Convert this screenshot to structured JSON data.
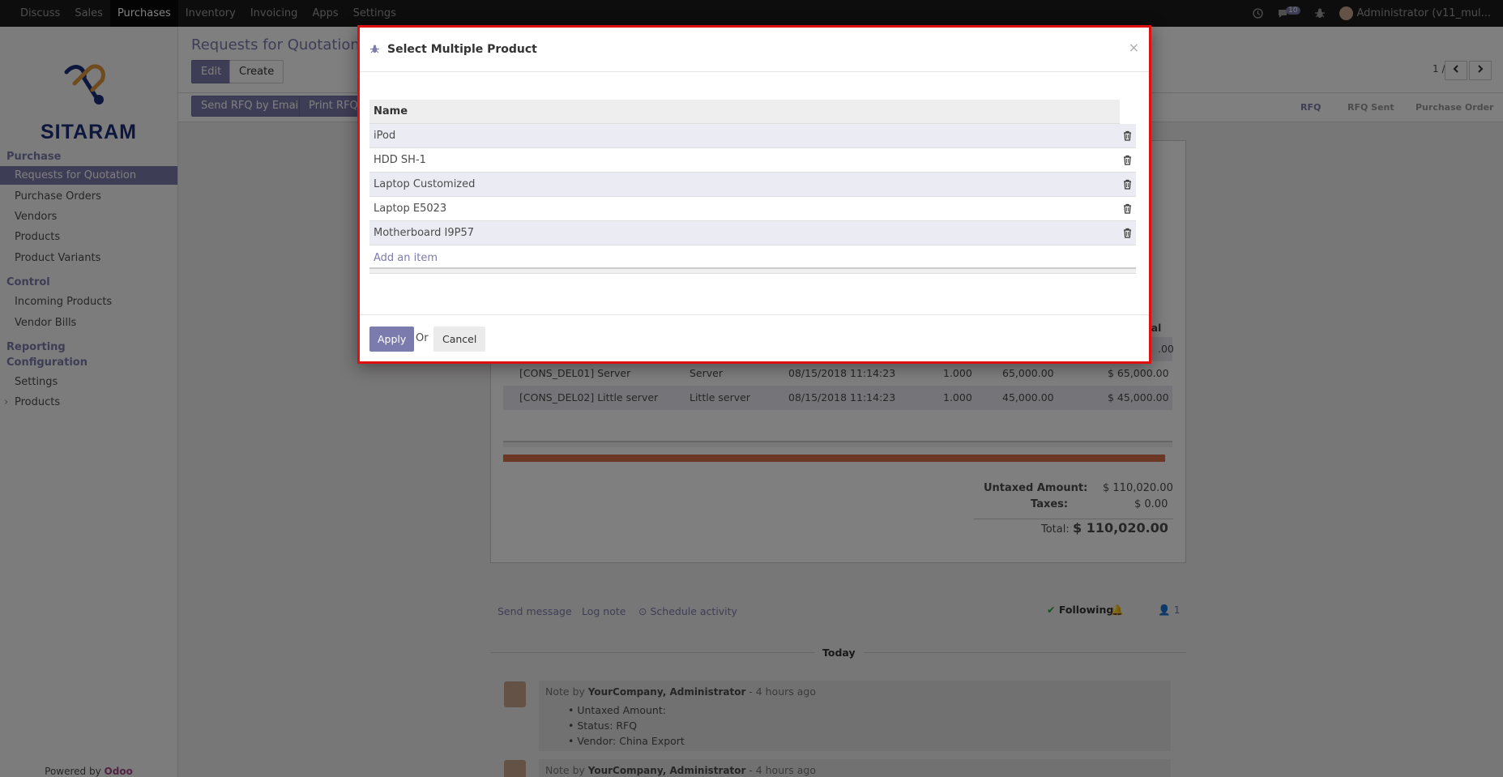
{
  "topbar": {
    "menu": [
      "Discuss",
      "Sales",
      "Purchases",
      "Inventory",
      "Invoicing",
      "Apps",
      "Settings"
    ],
    "active": "Purchases",
    "chat_count": "10",
    "user": "Administrator (v11_mul..."
  },
  "sidebar": {
    "logo_text": "SITARAM",
    "sections": {
      "purchase": "Purchase",
      "control": "Control",
      "reporting": "Reporting",
      "configuration": "Configuration"
    },
    "items": {
      "rfq": "Requests for Quotation",
      "po": "Purchase Orders",
      "vendors": "Vendors",
      "products": "Products",
      "variants": "Product Variants",
      "incoming": "Incoming Products",
      "bills": "Vendor Bills",
      "settings": "Settings",
      "config_products": "Products"
    },
    "powered_by": "Powered by",
    "powered_brand": "Odoo"
  },
  "content": {
    "breadcrumb": "Requests for Quotation /",
    "edit": "Edit",
    "create": "Create",
    "send_rfq": "Send RFQ by Email",
    "print_rfq": "Print RFQ",
    "pager": "1 / 8",
    "statuses": [
      "RFQ",
      "RFQ Sent",
      "Purchase Order"
    ],
    "col_total": "otal",
    "first_row_total": ".00",
    "lines": [
      {
        "product": "[CONS_DEL01] Server",
        "desc": "Server",
        "date": "08/15/2018 11:14:23",
        "qty": "1.000",
        "price": "65,000.00",
        "subtotal": "$ 65,000.00"
      },
      {
        "product": "[CONS_DEL02] Little server",
        "desc": "Little server",
        "date": "08/15/2018 11:14:23",
        "qty": "1.000",
        "price": "45,000.00",
        "subtotal": "$ 45,000.00"
      }
    ],
    "totals": {
      "untaxed_label": "Untaxed Amount:",
      "untaxed": "$ 110,020.00",
      "taxes_label": "Taxes:",
      "taxes": "$ 0.00",
      "total_label": "Total:",
      "total": "$ 110,020.00"
    },
    "chatter": {
      "send": "Send message",
      "log": "Log note",
      "schedule": "Schedule activity",
      "following": "Following",
      "followers": "1",
      "today": "Today",
      "note_prefix": "Note by",
      "author": "YourCompany, Administrator",
      "ago": "- 4 hours ago",
      "bullets": [
        "Untaxed Amount:",
        "Status: RFQ",
        "Vendor: China Export"
      ]
    }
  },
  "modal": {
    "title": "Select Multiple Product",
    "close": "×",
    "column": "Name",
    "rows": [
      "iPod",
      "HDD SH-1",
      "Laptop Customized",
      "Laptop E5023",
      "Motherboard I9P57"
    ],
    "add_item": "Add an item",
    "apply": "Apply",
    "or": "Or",
    "cancel": "Cancel"
  }
}
